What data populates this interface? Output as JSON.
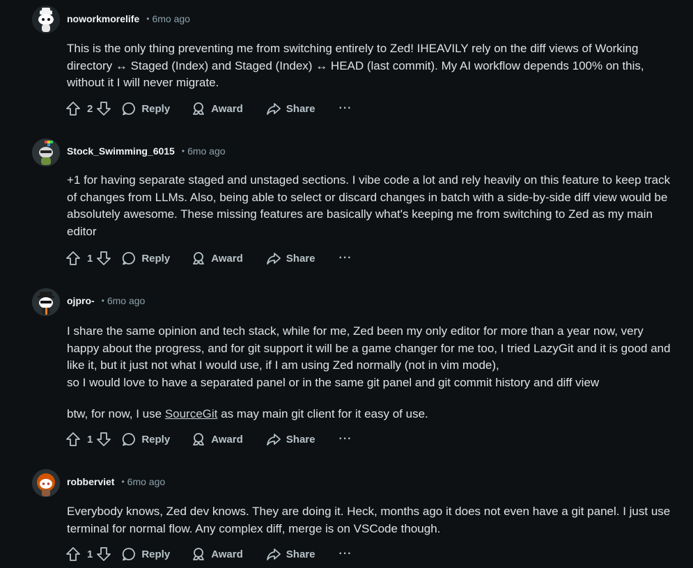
{
  "comments": [
    {
      "username": "noworkmorelife",
      "time": "6mo ago",
      "paragraphs": [
        "This is the only thing preventing me from switching entirely to Zed! IHEAVILY rely on the diff views of Working directory ↔ Staged (Index) and Staged (Index) ↔ HEAD (last commit). My AI workflow depends 100% on this, without it I will never migrate."
      ],
      "votes": "2"
    },
    {
      "username": "Stock_Swimming_6015",
      "time": "6mo ago",
      "paragraphs": [
        "+1 for having separate staged and unstaged sections. I vibe code a lot and rely heavily on this feature to keep track of changes from LLMs. Also, being able to select or discard changes in batch with a side-by-side diff view would be absolutely awesome. These missing features are basically what's keeping me from switching to Zed as my main editor"
      ],
      "votes": "1"
    },
    {
      "username": "ojpro-",
      "time": "6mo ago",
      "paragraphs": [
        "I share the same opinion and tech stack, while for me, Zed been my only editor for more than a year now, very happy about the progress, and for git support it will be a game changer for me too, I tried LazyGit and it is good and like it, but it just not what I would use, if I am using Zed normally (not in vim mode),",
        "so I would love to have a separated panel or in the same git panel and git commit history and diff view"
      ],
      "btw_before": "btw, for now, I use ",
      "btw_link": "SourceGit",
      "btw_after": " as may main git client for it easy of use.",
      "votes": "1"
    },
    {
      "username": "robberviet",
      "time": "6mo ago",
      "paragraphs": [
        "Everybody knows, Zed dev knows. They are doing it. Heck, months ago it does not even have a git panel. I just use terminal for normal flow. Any complex diff, merge is on VSCode though."
      ],
      "votes": "1"
    }
  ],
  "labels": {
    "separator": "•",
    "reply": "Reply",
    "award": "Award",
    "share": "Share",
    "more": "···"
  },
  "icons": [
    "snoo-avatar-icon",
    "upvote-icon",
    "downvote-icon",
    "reply-bubble-icon",
    "award-icon",
    "share-arrow-icon",
    "more-options-icon"
  ],
  "colors": {
    "background": "#0e1113",
    "username": "#f2f4f5",
    "meta": "#8ba2ad",
    "body": "#dfe3e5",
    "actions": "#b7c3c9"
  }
}
